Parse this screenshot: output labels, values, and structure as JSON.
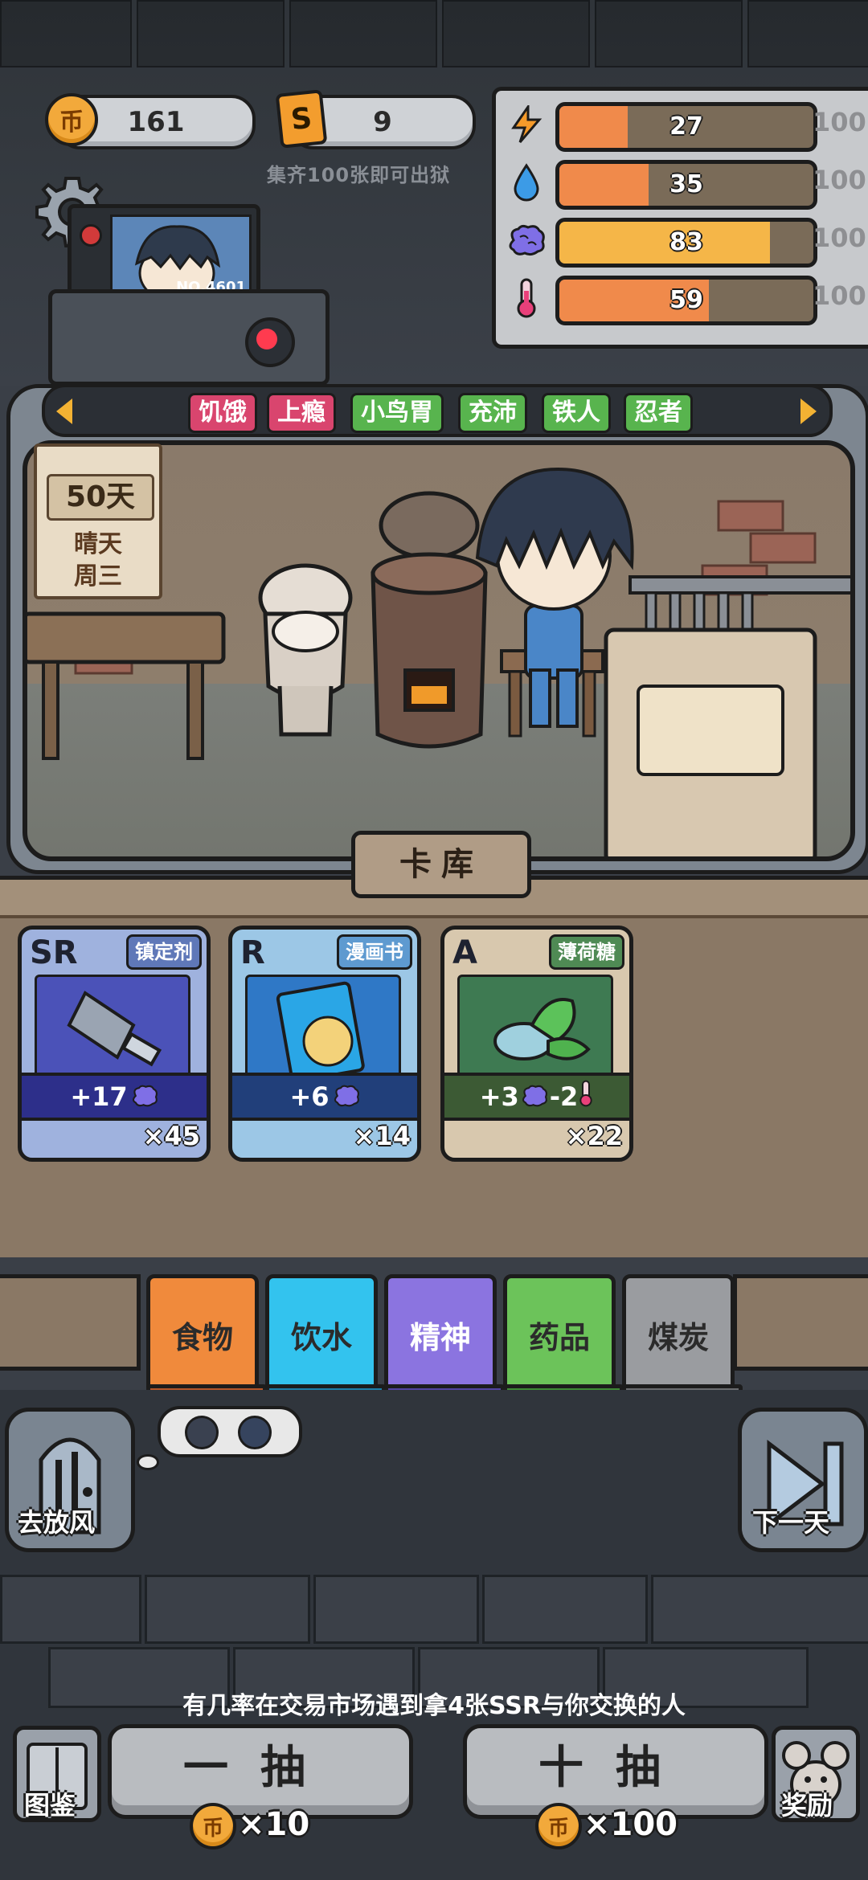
{
  "top": {
    "coins": "161",
    "coin_glyph": "币",
    "cards": "9",
    "card_glyph": "S",
    "hint": "集齐100张即可出狱"
  },
  "stats": [
    {
      "icon": "lightning-icon",
      "value": "27",
      "max": "100",
      "fraction": 0.27,
      "color": "#f08a4b"
    },
    {
      "icon": "water-drop-icon",
      "value": "35",
      "max": "100",
      "fraction": 0.35,
      "color": "#f08a4b"
    },
    {
      "icon": "brain-icon",
      "value": "83",
      "max": "100",
      "fraction": 0.83,
      "color": "#f5b648"
    },
    {
      "icon": "thermometer-icon",
      "value": "59",
      "max": "100",
      "fraction": 0.59,
      "color": "#f08a4b"
    }
  ],
  "character": {
    "badge": "NO.4601"
  },
  "tags": [
    "饥饿",
    "上瘾",
    "小鸟胃",
    "充沛",
    "铁人",
    "忍者"
  ],
  "calendar": {
    "days": "50天",
    "weather": "晴天",
    "weekday": "周三"
  },
  "scene_label": "卡库",
  "cards": [
    {
      "rarity": "SR",
      "name": "镇定剂",
      "effect": "+17",
      "count": "×45"
    },
    {
      "rarity": "R",
      "name": "漫画书",
      "effect": "+6",
      "count": "×14"
    },
    {
      "rarity": "A",
      "name": "薄荷糖",
      "effect": "+3",
      "effect2": "-2",
      "count": "×22"
    }
  ],
  "categories": [
    "食物",
    "饮水",
    "精神",
    "药品",
    "煤炭"
  ],
  "buttons": {
    "go_out": "去放风",
    "next_day": "下一天",
    "gallery": "图鉴",
    "reward": "奖励",
    "draw_one": "一抽",
    "draw_ten": "十抽",
    "price_one": "×10",
    "price_ten": "×100"
  },
  "notice": "有几率在交易市场遇到拿4张SSR与你交换的人",
  "colors": {
    "tag_negative": "#d9456e",
    "tag_positive": "#58b44e",
    "food": "#f08a3c",
    "water": "#33c3ee",
    "mind": "#8b74e0",
    "medicine": "#6cc35a",
    "coal": "#9a9ca0"
  }
}
